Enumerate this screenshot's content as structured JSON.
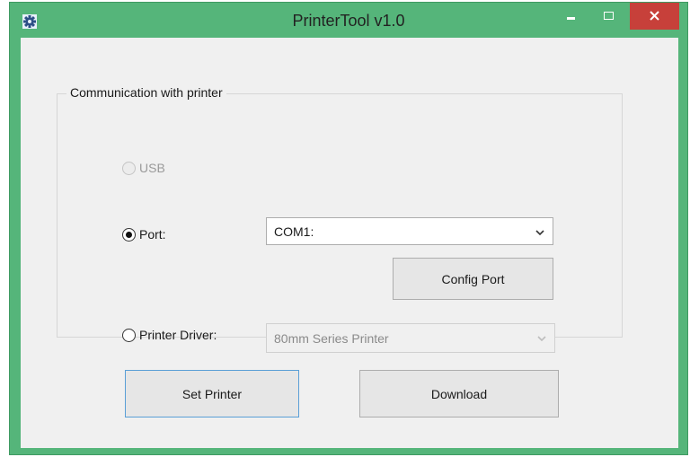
{
  "window": {
    "title": "PrinterTool v1.0",
    "icon": "gear-icon",
    "controls": [
      "minimize-icon",
      "maximize-icon",
      "close-icon"
    ]
  },
  "group": {
    "title": "Communication with printer",
    "usb": {
      "label": "USB",
      "enabled": false,
      "selected": false
    },
    "port": {
      "label": "Port:",
      "selected": true,
      "dropdown_value": "COM1:",
      "config_button": "Config Port"
    },
    "driver": {
      "label": "Printer Driver:",
      "selected": false,
      "dropdown_value": "80mm Series Printer",
      "enabled": false
    }
  },
  "buttons": {
    "set_printer": "Set Printer",
    "download": "Download"
  },
  "colors": {
    "title_bar": "#55b57a",
    "close_button": "#c7403a",
    "client_background": "#f0f0f0",
    "default_button_border": "#5a9fd6"
  }
}
